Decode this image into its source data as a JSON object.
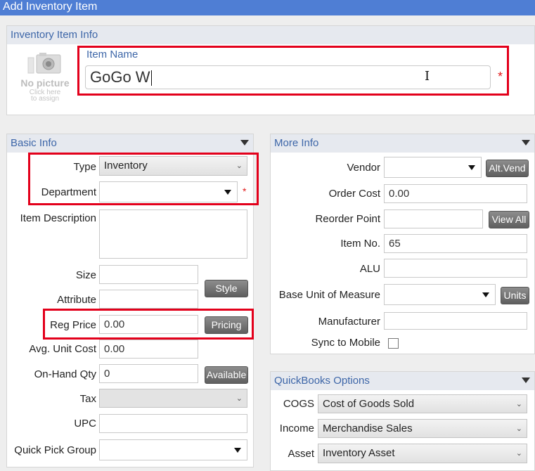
{
  "window": {
    "title": "Add Inventory Item"
  },
  "item_info": {
    "header": "Inventory Item Info",
    "no_picture": "No picture",
    "click_hint_1": "Click here",
    "click_hint_2": "to assign",
    "item_name_label": "Item Name",
    "item_name_value": "GoGo W",
    "required": "*"
  },
  "basic_info": {
    "header": "Basic Info",
    "type_label": "Type",
    "type_value": "Inventory",
    "department_label": "Department",
    "department_value": "",
    "item_description_label": "Item Description",
    "size_label": "Size",
    "attribute_label": "Attribute",
    "style_button": "Style",
    "reg_price_label": "Reg Price",
    "reg_price_value": "0.00",
    "pricing_button": "Pricing",
    "avg_unit_cost_label": "Avg. Unit Cost",
    "avg_unit_cost_value": "0.00",
    "on_hand_qty_label": "On-Hand Qty",
    "on_hand_qty_value": "0",
    "available_button": "Available",
    "tax_label": "Tax",
    "upc_label": "UPC",
    "quick_pick_group_label": "Quick Pick Group"
  },
  "more_info": {
    "header": "More Info",
    "vendor_label": "Vendor",
    "alt_vend_button": "Alt.Vend",
    "order_cost_label": "Order Cost",
    "order_cost_value": "0.00",
    "reorder_point_label": "Reorder Point",
    "view_all_button": "View All",
    "item_no_label": "Item No.",
    "item_no_value": "65",
    "alu_label": "ALU",
    "base_uom_label": "Base Unit of Measure",
    "units_button": "Units",
    "manufacturer_label": "Manufacturer",
    "sync_to_mobile_label": "Sync to Mobile"
  },
  "quickbooks": {
    "header": "QuickBooks Options",
    "cogs_label": "COGS",
    "cogs_value": "Cost of Goods Sold",
    "income_label": "Income",
    "income_value": "Merchandise Sales",
    "asset_label": "Asset",
    "asset_value": "Inventory Asset"
  },
  "colors": {
    "title_bar": "#4f7ed4",
    "section_header_text": "#3d66a8",
    "highlight_box": "#e3001b"
  }
}
